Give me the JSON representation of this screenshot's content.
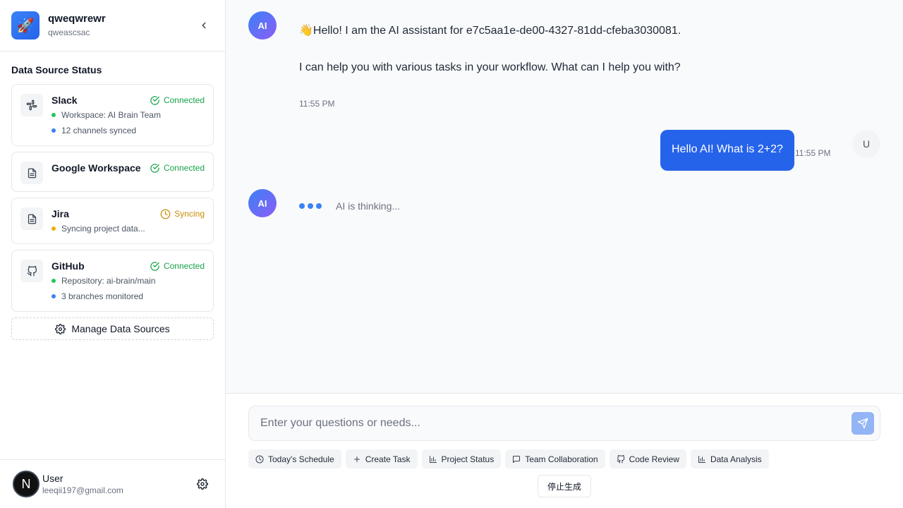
{
  "workspace": {
    "logo_icon": "rocket",
    "name": "qweqwrewr",
    "subtitle": "qweascsac"
  },
  "sidebar": {
    "section_title": "Data Source Status",
    "sources": [
      {
        "name": "Slack",
        "icon": "slack-icon",
        "status": "Connected",
        "status_color": "#16a34a",
        "details": [
          {
            "text": "Workspace: AI Brain Team",
            "dot": "green"
          },
          {
            "text": "12 channels synced",
            "dot": "blue"
          }
        ]
      },
      {
        "name": "Google Workspace",
        "icon": "document-icon",
        "status": "Connected",
        "status_color": "#16a34a",
        "details": []
      },
      {
        "name": "Jira",
        "icon": "document-icon",
        "status": "Syncing",
        "status_color": "#ca8a04",
        "details": [
          {
            "text": "Syncing project data...",
            "dot": "yellow"
          }
        ]
      },
      {
        "name": "GitHub",
        "icon": "github-icon",
        "status": "Connected",
        "status_color": "#16a34a",
        "details": [
          {
            "text": "Repository: ai-brain/main",
            "dot": "green"
          },
          {
            "text": "3 branches monitored",
            "dot": "blue"
          }
        ]
      }
    ],
    "manage_label": "Manage Data Sources"
  },
  "user": {
    "avatar_letter": "N",
    "name": "User",
    "email": "leeqii197@gmail.com"
  },
  "chat": {
    "messages": [
      {
        "role": "ai",
        "avatar": "AI",
        "emoji": "👋",
        "lines": [
          "Hello! I am the AI assistant for e7c5aa1e-de00-4327-81dd-cfeba3030081.",
          "I can help you with various tasks in your workflow. What can I help you with?"
        ],
        "time": "11:55 PM"
      },
      {
        "role": "user",
        "avatar": "U",
        "text": "Hello AI! What is 2+2?",
        "time": "11:55 PM"
      },
      {
        "role": "ai",
        "avatar": "AI",
        "thinking": "AI is thinking..."
      }
    ]
  },
  "composer": {
    "placeholder": "Enter your questions or needs...",
    "quick_actions": [
      {
        "label": "Today's Schedule",
        "icon": "clock-icon"
      },
      {
        "label": "Create Task",
        "icon": "plus-icon"
      },
      {
        "label": "Project Status",
        "icon": "bar-chart-icon"
      },
      {
        "label": "Team Collaboration",
        "icon": "message-icon"
      },
      {
        "label": "Code Review",
        "icon": "github-icon"
      },
      {
        "label": "Data Analysis",
        "icon": "bar-chart-icon"
      }
    ],
    "stop_label": "停止生成"
  },
  "colors": {
    "accent": "#2563eb",
    "connected": "#16a34a",
    "syncing": "#ca8a04"
  }
}
